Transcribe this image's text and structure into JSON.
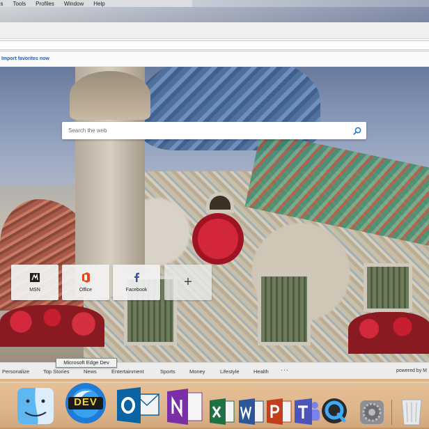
{
  "menubar": {
    "items": [
      "es",
      "Tools",
      "Profiles",
      "Window",
      "Help"
    ]
  },
  "favorites_bar": {
    "link": "Import favorites now"
  },
  "search": {
    "placeholder": "Search the web"
  },
  "quick_links": [
    {
      "label": "MSN",
      "icon": "msn-icon"
    },
    {
      "label": "Office",
      "icon": "office-icon"
    },
    {
      "label": "Facebook",
      "icon": "facebook-icon"
    },
    {
      "label": "",
      "icon": "plus-icon"
    }
  ],
  "bottom_nav": {
    "items": [
      "Personalize",
      "Top Stories",
      "News",
      "Entertainment",
      "Sports",
      "Money",
      "Lifestyle",
      "Health"
    ],
    "more": "···",
    "powered_by": "powered by M"
  },
  "tooltip": "Microsoft Edge Dev",
  "dock": {
    "edge_badge": "DEV",
    "apps": [
      "finder-icon",
      "edge-dev-icon",
      "outlook-icon",
      "onenote-icon",
      "excel-icon",
      "word-icon",
      "powerpoint-icon",
      "teams-icon",
      "quicktime-icon",
      "system-preferences-icon",
      "trash-icon"
    ]
  },
  "colors": {
    "link": "#1a5fb4",
    "search_icon": "#1a73c8",
    "office_red": "#e3471b",
    "facebook_blue": "#3b5998"
  }
}
